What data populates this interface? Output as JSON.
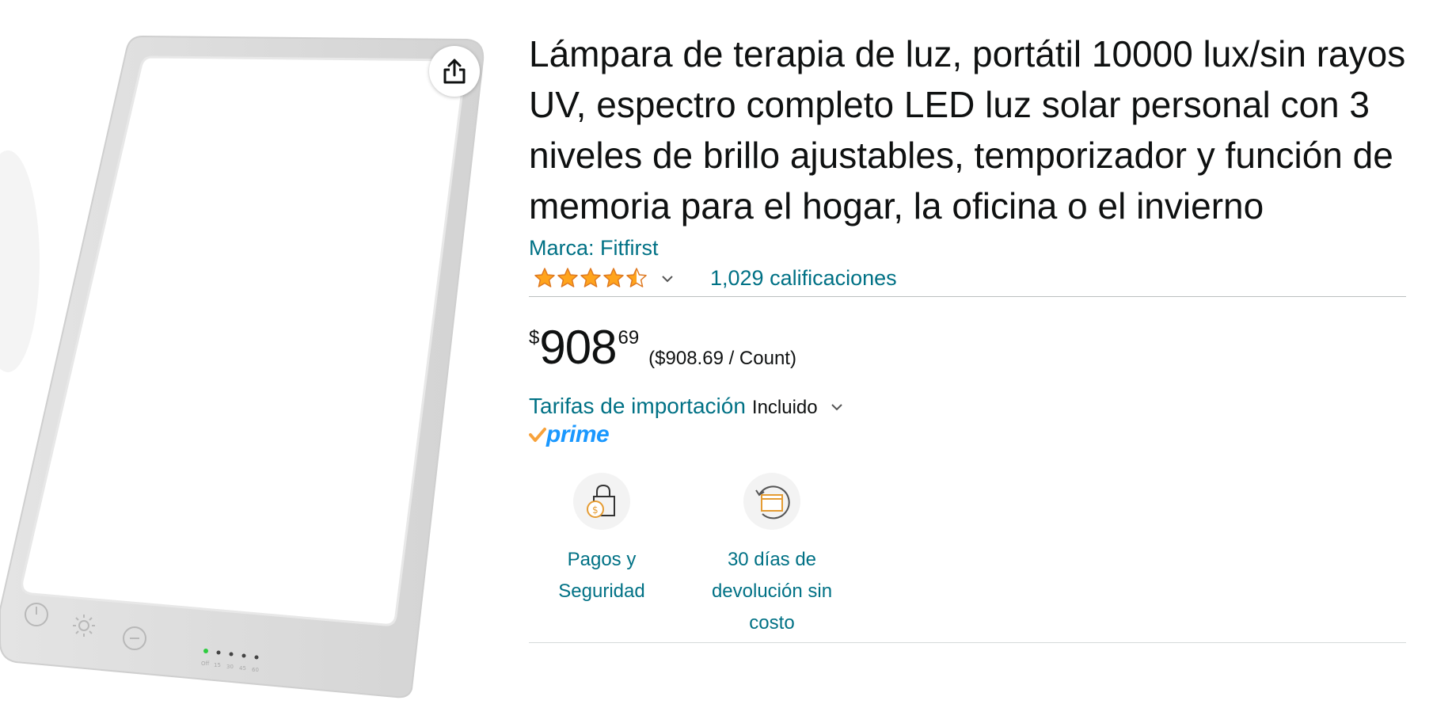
{
  "product": {
    "title": "Lámpara de terapia de luz, portátil 10000 lux/sin rayos UV, espectro completo LED luz solar personal con 3 niveles de brillo ajustables, temporizador y función de memoria para el hogar, la oficina o el invierno",
    "brand": "Marca: Fitfirst",
    "rating": {
      "stars": 4.5,
      "count_label": "1,029 calificaciones"
    },
    "price": {
      "symbol": "$",
      "whole": "908",
      "fraction": "69",
      "unit_price": "($908.69 / Count)"
    },
    "import_fees": {
      "label": "Tarifas de importación",
      "value": "Incluido"
    },
    "prime": "prime"
  },
  "image": {
    "share_icon": "share-icon",
    "lamp_buttons": [
      "power-icon",
      "brightness-icon",
      "timer-icon"
    ],
    "lamp_indicators": [
      "Off",
      "15",
      "30",
      "45",
      "60"
    ]
  },
  "features": [
    {
      "icon": "secure-payment-icon",
      "line1": "Pagos y",
      "line2": "Seguridad"
    },
    {
      "icon": "return-box-icon",
      "line1": "30 días de",
      "line2": "devolución sin",
      "line3": "costo"
    }
  ],
  "colors": {
    "link": "#007185",
    "star": "#FFA41C",
    "prime_blue": "#1a98ff",
    "prime_check": "#F7A23B",
    "text": "#0F1111"
  }
}
